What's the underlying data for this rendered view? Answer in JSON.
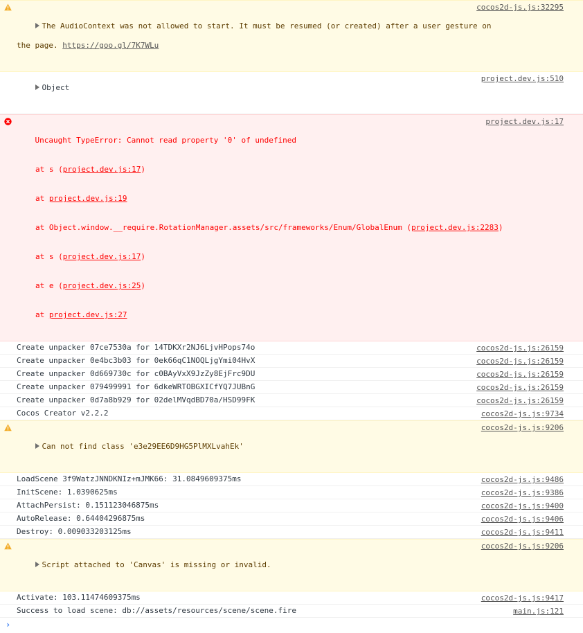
{
  "colors": {
    "warn_icon": "#f2ab26",
    "error_icon": "#fe0000",
    "prompt": "#367cf1"
  },
  "rows": [
    {
      "type": "warn",
      "text": "The AudioContext was not allowed to start. It must be resumed (or created) after a user gesture on",
      "text2": "the page. ",
      "link": "https://goo.gl/7K7WLu",
      "source": "cocos2d-js.js:32295"
    },
    {
      "type": "log",
      "text": "Object",
      "source": "project.dev.js:510"
    },
    {
      "type": "error",
      "text": "Uncaught TypeError: Cannot read property '0' of undefined",
      "source": "project.dev.js:17",
      "stack": [
        {
          "pre": "at s (",
          "link": "project.dev.js:17",
          "post": ")"
        },
        {
          "pre": "at ",
          "link": "project.dev.js:19",
          "post": ""
        },
        {
          "pre": "at Object.window.__require.RotationManager.assets/src/frameworks/Enum/GlobalEnum (",
          "link": "project.dev.js:2283",
          "post": ")"
        },
        {
          "pre": "at s (",
          "link": "project.dev.js:17",
          "post": ")"
        },
        {
          "pre": "at e (",
          "link": "project.dev.js:25",
          "post": ")"
        },
        {
          "pre": "at ",
          "link": "project.dev.js:27",
          "post": ""
        }
      ]
    },
    {
      "type": "log",
      "text": "Create unpacker 07ce7530a for 14TDKXr2NJ6LjvHPops74o",
      "source": "cocos2d-js.js:26159"
    },
    {
      "type": "log",
      "text": "Create unpacker 0e4bc3b03 for 0ek66qC1NOQLjgYmi04HvX",
      "source": "cocos2d-js.js:26159"
    },
    {
      "type": "log",
      "text": "Create unpacker 0d669730c for c0BAyVxX9JzZy8EjFrc9DU",
      "source": "cocos2d-js.js:26159"
    },
    {
      "type": "log",
      "text": "Create unpacker 079499991 for 6dkeWRTOBGXICfYQ7JUBnG",
      "source": "cocos2d-js.js:26159"
    },
    {
      "type": "log",
      "text": "Create unpacker 0d7a8b929 for 02delMVqdBD70a/HSD99FK",
      "source": "cocos2d-js.js:26159"
    },
    {
      "type": "log",
      "text": "Cocos Creator v2.2.2",
      "source": "cocos2d-js.js:9734"
    },
    {
      "type": "warn",
      "text": "Can not find class 'e3e29EE6D9HG5PlMXLvahEk'",
      "source": "cocos2d-js.js:9206"
    },
    {
      "type": "log",
      "text": "LoadScene 3f9WatzJNNDKNIz+mJMK66: 31.0849609375ms",
      "source": "cocos2d-js.js:9486"
    },
    {
      "type": "log",
      "text": "InitScene: 1.0390625ms",
      "source": "cocos2d-js.js:9386"
    },
    {
      "type": "log",
      "text": "AttachPersist: 0.151123046875ms",
      "source": "cocos2d-js.js:9400"
    },
    {
      "type": "log",
      "text": "AutoRelease: 0.64404296875ms",
      "source": "cocos2d-js.js:9406"
    },
    {
      "type": "log",
      "text": "Destroy: 0.009033203125ms",
      "source": "cocos2d-js.js:9411"
    },
    {
      "type": "warn",
      "text": "Script attached to 'Canvas' is missing or invalid.",
      "source": "cocos2d-js.js:9206"
    },
    {
      "type": "log",
      "text": "Activate: 103.11474609375ms",
      "source": "cocos2d-js.js:9417"
    },
    {
      "type": "log",
      "text": "Success to load scene: db://assets/resources/scene/scene.fire",
      "source": "main.js:121"
    }
  ],
  "prompt_symbol": "›"
}
